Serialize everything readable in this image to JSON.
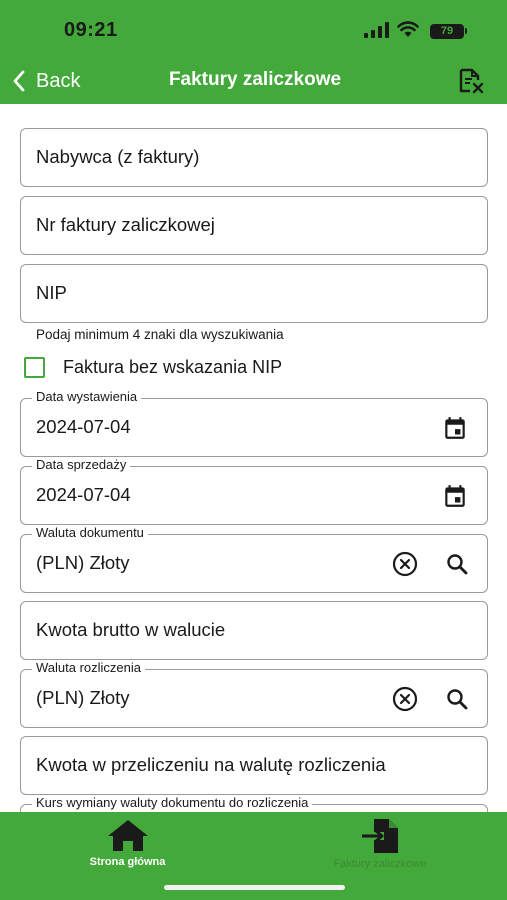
{
  "status_bar": {
    "time": "09:21",
    "battery": "79"
  },
  "header": {
    "back_label": "Back",
    "title": "Faktury zaliczkowe"
  },
  "form": {
    "buyer_placeholder": "Nabywca (z faktury)",
    "invoice_number_placeholder": "Nr faktury zaliczkowej",
    "nip_placeholder": "NIP",
    "nip_hint": "Podaj minimum 4 znaki dla wyszukiwania",
    "no_nip_checkbox": {
      "label": "Faktura bez wskazania NIP",
      "checked": false
    },
    "issue_date": {
      "label": "Data wystawienia",
      "value": "2024-07-04"
    },
    "sale_date": {
      "label": "Data sprzedaży",
      "value": "2024-07-04"
    },
    "document_currency": {
      "label": "Waluta dokumentu",
      "value": "(PLN) Złoty"
    },
    "gross_amount_placeholder": "Kwota brutto w walucie",
    "settlement_currency": {
      "label": "Waluta rozliczenia",
      "value": "(PLN) Złoty"
    },
    "converted_amount_placeholder": "Kwota w przeliczeniu na walutę rozliczenia",
    "exchange_rate_label": "Kurs wymiany waluty dokumentu do rozliczenia"
  },
  "bottom_nav": {
    "items": [
      {
        "label": "Strona główna",
        "icon": "home-icon",
        "active": true
      },
      {
        "label": "Faktury zaliczkowe",
        "icon": "document-import-icon",
        "active": false
      }
    ]
  },
  "colors": {
    "brand_green": "#43a93a",
    "inactive_nav": "#3c8a34",
    "field_border": "#9a9a9a"
  }
}
